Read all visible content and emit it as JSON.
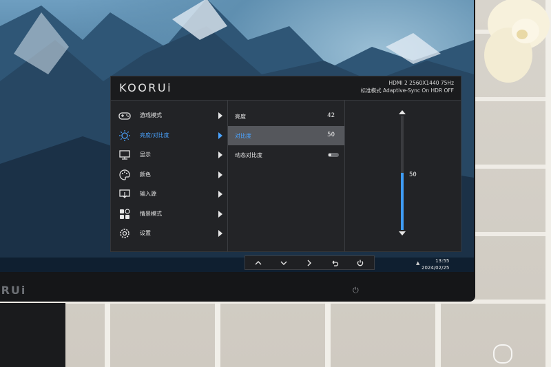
{
  "osd": {
    "brand": "KOORUi",
    "signal_line1": "HDMI 2  2560X1440  75Hz",
    "signal_line2": "标准模式    Adaptive-Sync On    HDR OFF",
    "menu": [
      {
        "label": "游戏模式",
        "icon": "gamepad-icon"
      },
      {
        "label": "亮度/对比度",
        "icon": "brightness-icon",
        "active": true
      },
      {
        "label": "显示",
        "icon": "display-icon"
      },
      {
        "label": "颜色",
        "icon": "palette-icon"
      },
      {
        "label": "输入源",
        "icon": "input-source-icon"
      },
      {
        "label": "情景模式",
        "icon": "scene-mode-icon"
      },
      {
        "label": "设置",
        "icon": "settings-gear-icon"
      }
    ],
    "submenu": [
      {
        "label": "亮度",
        "value": "42"
      },
      {
        "label": "对比度",
        "value": "50",
        "active": true
      },
      {
        "label": "动态对比度",
        "value": null,
        "toggle": "off"
      }
    ],
    "slider": {
      "value": "50",
      "level": 0.5
    }
  },
  "buttons": [
    {
      "name": "up-button",
      "icon": "chevron-up-icon"
    },
    {
      "name": "down-button",
      "icon": "chevron-down-icon"
    },
    {
      "name": "right-button",
      "icon": "chevron-right-icon"
    },
    {
      "name": "back-button",
      "icon": "return-icon"
    },
    {
      "name": "power-button",
      "icon": "power-icon"
    }
  ],
  "taskbar": {
    "time": "13:55",
    "date": "2024/02/25"
  },
  "bezel": {
    "logo": "ORUi"
  },
  "colors": {
    "accent": "#4aa3ff",
    "osd_bg": "#202124",
    "slider_fill": "#3f9cf7"
  }
}
